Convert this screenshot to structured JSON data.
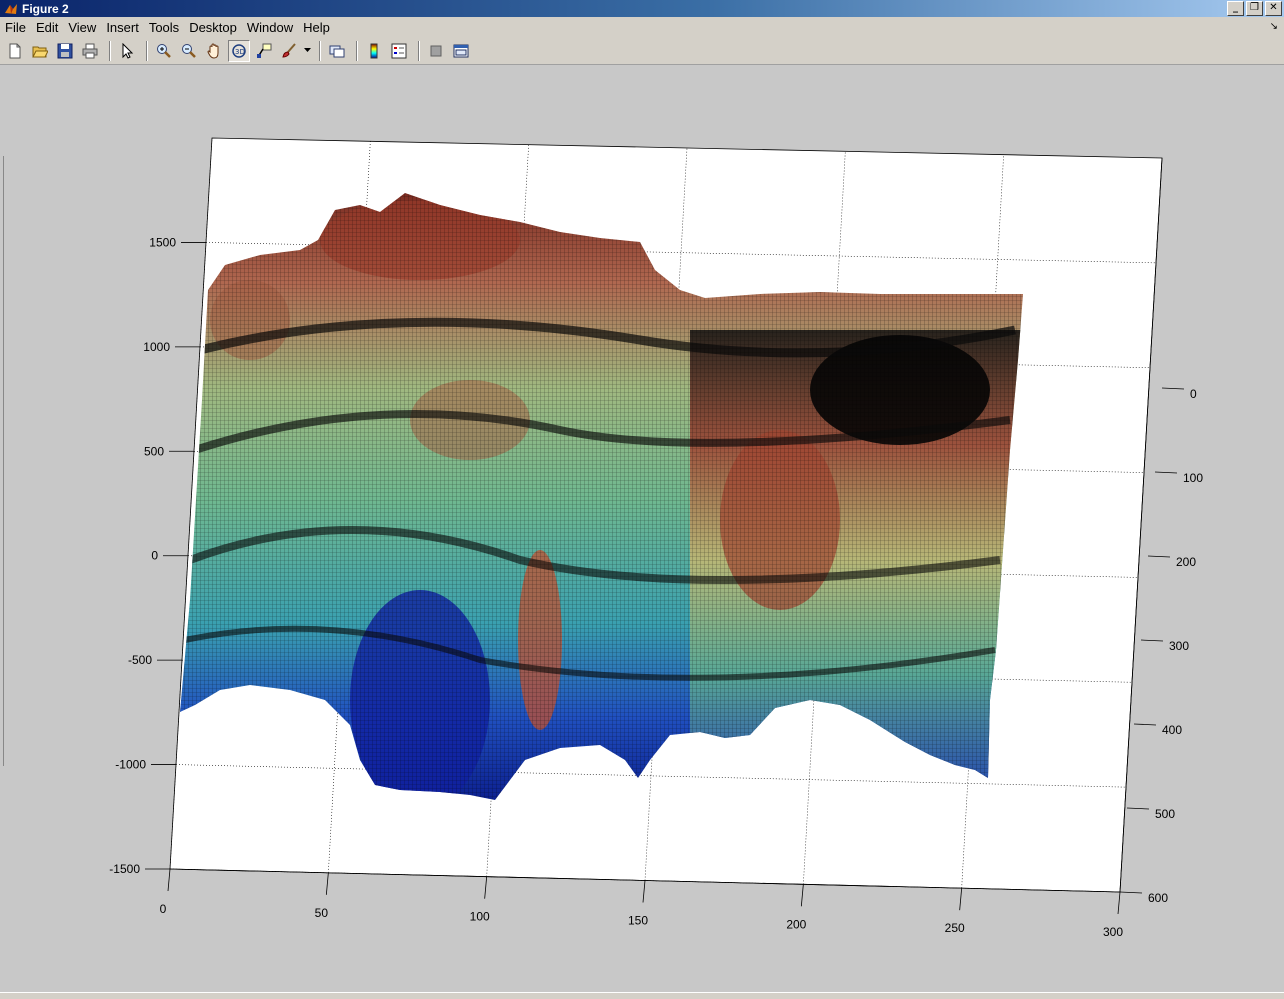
{
  "window": {
    "title": "Figure 2",
    "buttons": [
      "minimize",
      "restore",
      "close"
    ]
  },
  "menu": [
    "File",
    "Edit",
    "View",
    "Insert",
    "Tools",
    "Desktop",
    "Window",
    "Help"
  ],
  "toolbar": {
    "buttons": [
      {
        "name": "new-figure-icon"
      },
      {
        "name": "open-file-icon"
      },
      {
        "name": "save-figure-icon"
      },
      {
        "name": "print-figure-icon"
      },
      {
        "name": "edit-plot-arrow-icon"
      },
      {
        "name": "zoom-in-icon"
      },
      {
        "name": "zoom-out-icon"
      },
      {
        "name": "pan-hand-icon"
      },
      {
        "name": "rotate-3d-icon",
        "pressed": true
      },
      {
        "name": "data-cursor-icon"
      },
      {
        "name": "brush-icon"
      },
      {
        "name": "link-plot-icon"
      },
      {
        "name": "insert-colorbar-icon"
      },
      {
        "name": "insert-legend-icon"
      },
      {
        "name": "hide-plot-tools-icon"
      },
      {
        "name": "show-plot-tools-icon"
      }
    ]
  },
  "chart_data": {
    "type": "surface",
    "colormap": "jet-like, lit mesh",
    "grid": true,
    "x_axis": {
      "ticks": [
        0,
        50,
        100,
        150,
        200,
        250,
        300
      ],
      "range": [
        0,
        300
      ]
    },
    "y_axis": {
      "ticks": [
        0,
        100,
        200,
        300,
        400,
        500,
        600
      ],
      "range": [
        0,
        600
      ]
    },
    "z_axis": {
      "ticks": [
        -1500,
        -1000,
        -500,
        0,
        500,
        1000,
        1500
      ],
      "range": [
        -1500,
        2000
      ]
    }
  }
}
